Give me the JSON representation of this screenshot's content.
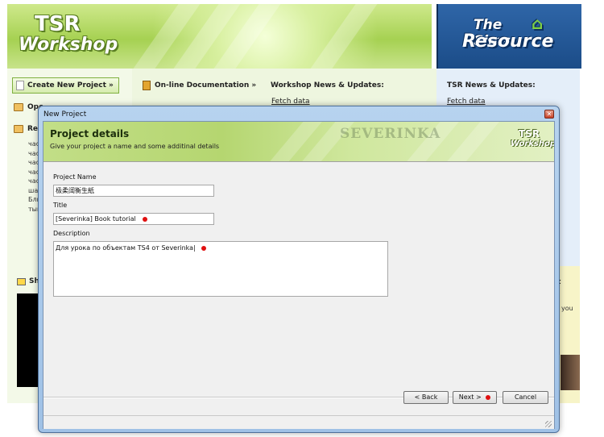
{
  "app": {
    "logo_line1": "TSR",
    "logo_line2": "Workshop",
    "sims_logo_line1": "The Sims",
    "sims_logo_line2": "Resource",
    "create_new_project": "Create New Project »",
    "online_documentation": "On-line Documentation »",
    "workshop_news_title": "Workshop News & Updates:",
    "workshop_news_fetch": "Fetch data",
    "tsr_news_title": "TSR News & Updates:",
    "tsr_news_fetch": "Fetch data",
    "open_label": "Ope",
    "recent_label": "Rec",
    "recent_items": [
      "час",
      "час",
      "час",
      "час",
      "час",
      "шаб",
      "Бли",
      "тый"
    ],
    "share_label": "Sho",
    "right_fragment_1": "t",
    "right_fragment_2": "you"
  },
  "dialog": {
    "title": "New Project",
    "close_glyph": "✕",
    "banner_title": "Project details",
    "banner_subtitle": "Give your project a name and some additinal details",
    "watermark": "SEVERINKA",
    "mini_logo_1": "TSR",
    "mini_logo_2": "Workshop",
    "project_name_label": "Project Name",
    "project_name_value": "极柔阔衡生紙",
    "title_label": "Title",
    "title_value": "[Severinka] Book tutorial",
    "description_label": "Description",
    "description_value": "Для урока по объектам TS4 от Severinka|",
    "back_button": "< Back",
    "next_button": "Next >",
    "cancel_button": "Cancel"
  },
  "colors": {
    "header_green": "#a6d152",
    "header_blue": "#1b4c88",
    "dialog_frame": "#b7d3ef",
    "annotation_red": "#e01010"
  }
}
